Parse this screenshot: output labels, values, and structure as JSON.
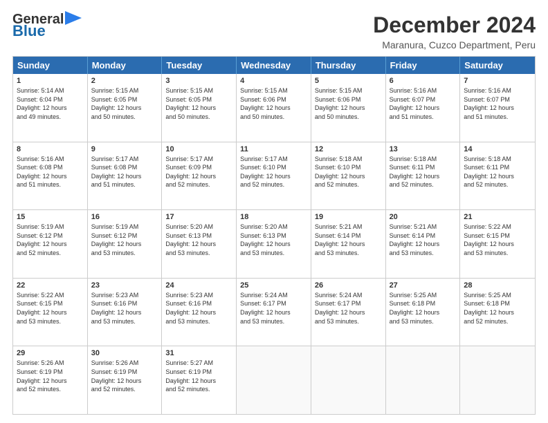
{
  "logo": {
    "general": "General",
    "blue": "Blue"
  },
  "header": {
    "month_year": "December 2024",
    "location": "Maranura, Cuzco Department, Peru"
  },
  "weekdays": [
    "Sunday",
    "Monday",
    "Tuesday",
    "Wednesday",
    "Thursday",
    "Friday",
    "Saturday"
  ],
  "rows": [
    [
      {
        "day": "",
        "info": ""
      },
      {
        "day": "2",
        "info": "Sunrise: 5:15 AM\nSunset: 6:05 PM\nDaylight: 12 hours\nand 50 minutes."
      },
      {
        "day": "3",
        "info": "Sunrise: 5:15 AM\nSunset: 6:05 PM\nDaylight: 12 hours\nand 50 minutes."
      },
      {
        "day": "4",
        "info": "Sunrise: 5:15 AM\nSunset: 6:06 PM\nDaylight: 12 hours\nand 50 minutes."
      },
      {
        "day": "5",
        "info": "Sunrise: 5:15 AM\nSunset: 6:06 PM\nDaylight: 12 hours\nand 50 minutes."
      },
      {
        "day": "6",
        "info": "Sunrise: 5:16 AM\nSunset: 6:07 PM\nDaylight: 12 hours\nand 51 minutes."
      },
      {
        "day": "7",
        "info": "Sunrise: 5:16 AM\nSunset: 6:07 PM\nDaylight: 12 hours\nand 51 minutes."
      }
    ],
    [
      {
        "day": "8",
        "info": "Sunrise: 5:16 AM\nSunset: 6:08 PM\nDaylight: 12 hours\nand 51 minutes."
      },
      {
        "day": "9",
        "info": "Sunrise: 5:17 AM\nSunset: 6:08 PM\nDaylight: 12 hours\nand 51 minutes."
      },
      {
        "day": "10",
        "info": "Sunrise: 5:17 AM\nSunset: 6:09 PM\nDaylight: 12 hours\nand 52 minutes."
      },
      {
        "day": "11",
        "info": "Sunrise: 5:17 AM\nSunset: 6:10 PM\nDaylight: 12 hours\nand 52 minutes."
      },
      {
        "day": "12",
        "info": "Sunrise: 5:18 AM\nSunset: 6:10 PM\nDaylight: 12 hours\nand 52 minutes."
      },
      {
        "day": "13",
        "info": "Sunrise: 5:18 AM\nSunset: 6:11 PM\nDaylight: 12 hours\nand 52 minutes."
      },
      {
        "day": "14",
        "info": "Sunrise: 5:18 AM\nSunset: 6:11 PM\nDaylight: 12 hours\nand 52 minutes."
      }
    ],
    [
      {
        "day": "15",
        "info": "Sunrise: 5:19 AM\nSunset: 6:12 PM\nDaylight: 12 hours\nand 52 minutes."
      },
      {
        "day": "16",
        "info": "Sunrise: 5:19 AM\nSunset: 6:12 PM\nDaylight: 12 hours\nand 53 minutes."
      },
      {
        "day": "17",
        "info": "Sunrise: 5:20 AM\nSunset: 6:13 PM\nDaylight: 12 hours\nand 53 minutes."
      },
      {
        "day": "18",
        "info": "Sunrise: 5:20 AM\nSunset: 6:13 PM\nDaylight: 12 hours\nand 53 minutes."
      },
      {
        "day": "19",
        "info": "Sunrise: 5:21 AM\nSunset: 6:14 PM\nDaylight: 12 hours\nand 53 minutes."
      },
      {
        "day": "20",
        "info": "Sunrise: 5:21 AM\nSunset: 6:14 PM\nDaylight: 12 hours\nand 53 minutes."
      },
      {
        "day": "21",
        "info": "Sunrise: 5:22 AM\nSunset: 6:15 PM\nDaylight: 12 hours\nand 53 minutes."
      }
    ],
    [
      {
        "day": "22",
        "info": "Sunrise: 5:22 AM\nSunset: 6:15 PM\nDaylight: 12 hours\nand 53 minutes."
      },
      {
        "day": "23",
        "info": "Sunrise: 5:23 AM\nSunset: 6:16 PM\nDaylight: 12 hours\nand 53 minutes."
      },
      {
        "day": "24",
        "info": "Sunrise: 5:23 AM\nSunset: 6:16 PM\nDaylight: 12 hours\nand 53 minutes."
      },
      {
        "day": "25",
        "info": "Sunrise: 5:24 AM\nSunset: 6:17 PM\nDaylight: 12 hours\nand 53 minutes."
      },
      {
        "day": "26",
        "info": "Sunrise: 5:24 AM\nSunset: 6:17 PM\nDaylight: 12 hours\nand 53 minutes."
      },
      {
        "day": "27",
        "info": "Sunrise: 5:25 AM\nSunset: 6:18 PM\nDaylight: 12 hours\nand 53 minutes."
      },
      {
        "day": "28",
        "info": "Sunrise: 5:25 AM\nSunset: 6:18 PM\nDaylight: 12 hours\nand 52 minutes."
      }
    ],
    [
      {
        "day": "29",
        "info": "Sunrise: 5:26 AM\nSunset: 6:19 PM\nDaylight: 12 hours\nand 52 minutes."
      },
      {
        "day": "30",
        "info": "Sunrise: 5:26 AM\nSunset: 6:19 PM\nDaylight: 12 hours\nand 52 minutes."
      },
      {
        "day": "31",
        "info": "Sunrise: 5:27 AM\nSunset: 6:19 PM\nDaylight: 12 hours\nand 52 minutes."
      },
      {
        "day": "",
        "info": ""
      },
      {
        "day": "",
        "info": ""
      },
      {
        "day": "",
        "info": ""
      },
      {
        "day": "",
        "info": ""
      }
    ]
  ],
  "row0_day1": {
    "day": "1",
    "info": "Sunrise: 5:14 AM\nSunset: 6:04 PM\nDaylight: 12 hours\nand 49 minutes."
  }
}
